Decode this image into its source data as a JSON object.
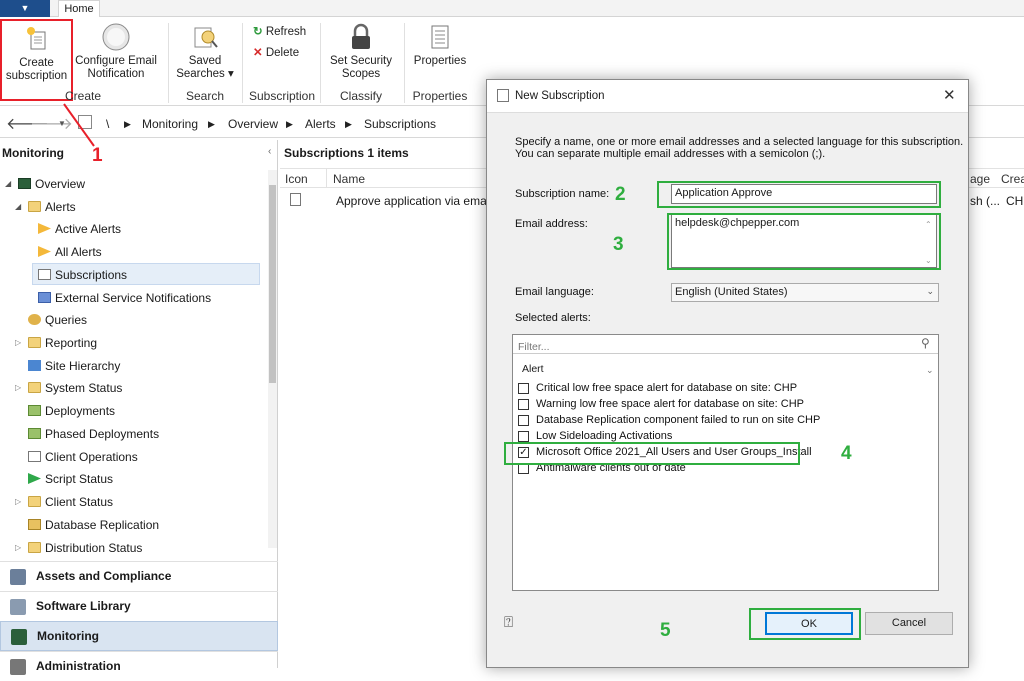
{
  "ribbon": {
    "tab": "Home",
    "create_subscription": "Create subscription",
    "configure_email": "Configure Email Notification",
    "saved_searches": "Saved Searches ▾",
    "refresh": "Refresh",
    "delete": "Delete",
    "set_security_scopes": "Set Security Scopes",
    "properties": "Properties",
    "groups": [
      "Create",
      "Search",
      "Subscription",
      "Classify",
      "Properties"
    ]
  },
  "breadcrumb": [
    "\\",
    "Monitoring",
    "Overview",
    "Alerts",
    "Subscriptions"
  ],
  "nav": {
    "title": "Monitoring",
    "items": [
      {
        "label": "Overview"
      },
      {
        "label": "Alerts"
      },
      {
        "label": "Active Alerts"
      },
      {
        "label": "All Alerts"
      },
      {
        "label": "Subscriptions"
      },
      {
        "label": "External Service Notifications"
      },
      {
        "label": "Queries"
      },
      {
        "label": "Reporting"
      },
      {
        "label": "Site Hierarchy"
      },
      {
        "label": "System Status"
      },
      {
        "label": "Deployments"
      },
      {
        "label": "Phased Deployments"
      },
      {
        "label": "Client Operations"
      },
      {
        "label": "Script Status"
      },
      {
        "label": "Client Status"
      },
      {
        "label": "Database Replication"
      },
      {
        "label": "Distribution Status"
      }
    ],
    "workspaces": [
      "Assets and Compliance",
      "Software Library",
      "Monitoring",
      "Administration"
    ]
  },
  "list": {
    "title": "Subscriptions 1 items",
    "columns": [
      "Icon",
      "Name",
      "age",
      "Crea"
    ],
    "rows": [
      {
        "name": "Approve application via email",
        "lang": "sh (...",
        "creator": "CHP"
      }
    ]
  },
  "dialog": {
    "title": "New Subscription",
    "intro1": "Specify a name, one or more email addresses and a selected language for this subscription.",
    "intro2": "You can separate multiple email addresses with a semicolon (;).",
    "name_label": "Subscription name:",
    "name_value": "Application Approve",
    "email_label": "Email address:",
    "email_value": "helpdesk@chpepper.com",
    "language_label": "Email language:",
    "language_value": "English (United States)",
    "selected_label": "Selected alerts:",
    "filter_placeholder": "Filter...",
    "alert_header": "Alert",
    "alerts": [
      {
        "label": "Critical low free space alert for database on site: CHP",
        "checked": false
      },
      {
        "label": "Warning low free space alert for database on site: CHP",
        "checked": false
      },
      {
        "label": "Database Replication component failed to run on site CHP",
        "checked": false
      },
      {
        "label": "Low Sideloading Activations",
        "checked": false
      },
      {
        "label": "Microsoft Office 2021_All Users and User Groups_Install",
        "checked": true
      },
      {
        "label": "Antimalware clients out of date",
        "checked": false
      }
    ],
    "ok": "OK",
    "cancel": "Cancel"
  },
  "annotations": [
    "1",
    "2",
    "3",
    "4",
    "5"
  ],
  "colors": {
    "annotation_red": "#e8202a",
    "annotation_green": "#2fae3f",
    "app_menu": "#1e4e8c"
  }
}
